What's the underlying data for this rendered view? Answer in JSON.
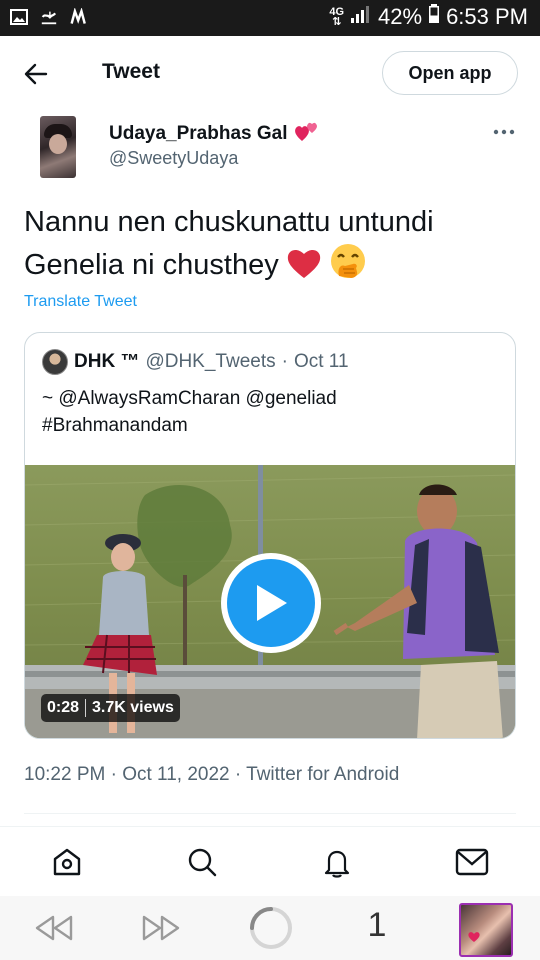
{
  "status_bar": {
    "network": "4G",
    "battery": "42%",
    "time": "6:53 PM"
  },
  "header": {
    "title": "Tweet",
    "open_app_label": "Open app"
  },
  "tweet": {
    "author_name": "Udaya_Prabhas Gal",
    "author_handle": "@SweetyUdaya",
    "text_line1": "Nannu nen chuskunattu untundi",
    "text_line2": "Genelia ni chusthey",
    "translate_label": "Translate Tweet",
    "timestamp": "10:22 PM · Oct 11, 2022 · Twitter for Android"
  },
  "quoted_tweet": {
    "author_name": "DHK ™",
    "author_handle": "@DHK_Tweets",
    "separator": "·",
    "date": "Oct 11",
    "text_line1": "~ @AlwaysRamCharan @geneliad",
    "text_line2": "#Brahmanandam",
    "video_duration": "0:28",
    "video_views": "3.7K views"
  },
  "bottom_nav": {
    "items": [
      "home-icon",
      "search-icon",
      "notifications-icon",
      "messages-icon"
    ]
  },
  "browser_bar": {
    "tab_count": "1"
  },
  "colors": {
    "accent": "#1d9bf0",
    "secondary_text": "#536471",
    "border": "#cfd9de",
    "heart": "#e0245e",
    "status_bar_bg": "#1a1a1a"
  }
}
